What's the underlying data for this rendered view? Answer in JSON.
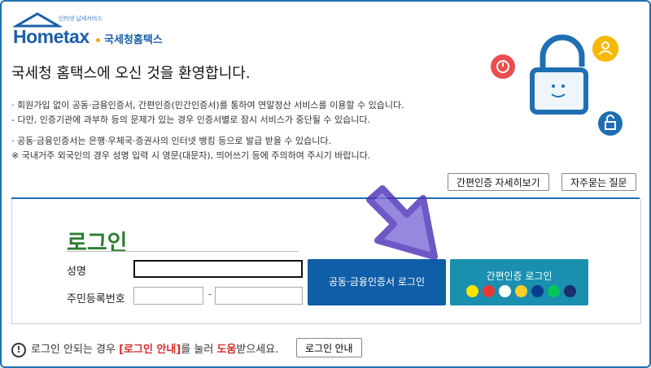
{
  "logo": {
    "brand": "Hometax",
    "tagline": "인터넷 납세서비스",
    "agency": "국세청홈택스"
  },
  "welcome_title": "국세청 홈택스에 오신 것을 환영합니다.",
  "notices": [
    "· 회원가입 없이 공동·금융인증서, 간편인증(민간인증서)를 통하여 연말정산 서비스를 이용할 수 있습니다.",
    "  - 다만, 인증기관에 과부하 등의 문제가 있는 경우 인증서별로 잠시 서비스가 중단될 수 있습니다.",
    "· 공동·금융인증서는 은행·우체국·증권사의 인터넷 뱅킹 등으로 발급 받을 수 있습니다.",
    "※ 국내거주 외국인의 경우 성명 입력 시 영문(대문자), 띄어쓰기 등에 주의하여 주시기 바랍니다."
  ],
  "buttons": {
    "simple_auth_detail": "간편인증 자세히보기",
    "faq": "자주묻는 질문",
    "cert_login": "공동·금융인증서 로그인",
    "simple_login": "간편인증 로그인",
    "login_guide": "로그인 안내"
  },
  "login": {
    "title": "로그인",
    "name_label": "성명",
    "rrn_label": "주민등록번호",
    "name_value": "",
    "rrn_front": "",
    "rrn_back": "",
    "dash": "-"
  },
  "footer": {
    "text_a": "로그인 안되는 경우 ",
    "highlight": "[로그인 안내]",
    "text_b": "를 눌러 ",
    "help": "도움",
    "text_c": "받으세요."
  },
  "colors": {
    "primary": "#0f5ea8",
    "simple": "#1a8fb0",
    "accent_green": "#2e7d32",
    "arrow": "#5b3fc4"
  }
}
